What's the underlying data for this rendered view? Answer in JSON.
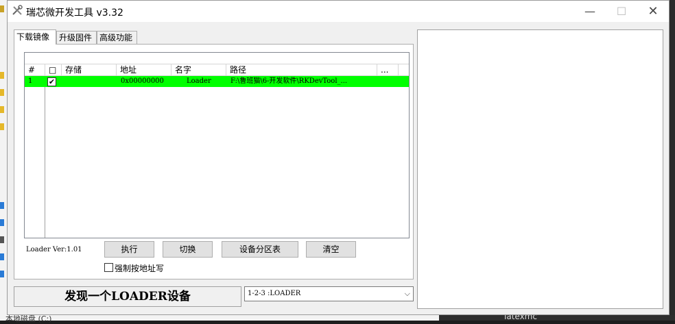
{
  "window": {
    "title": "瑞芯微开发工具 v3.32"
  },
  "tabs": [
    {
      "label": "下载镜像"
    },
    {
      "label": "升级固件"
    },
    {
      "label": "高级功能"
    }
  ],
  "list": {
    "headers": [
      "#",
      "□",
      "存储",
      "地址",
      "名字",
      "路径",
      "..."
    ],
    "rows": [
      {
        "index": "1",
        "checked": "✔",
        "storage": "",
        "address": "0x00000000",
        "name": "Loader",
        "path": "F:\\鲁班猫\\6-开发软件\\RKDevTool_..."
      }
    ]
  },
  "panel": {
    "loader_ver": "Loader Ver:1.01",
    "buttons": {
      "execute": "执行",
      "switch": "切换",
      "partition": "设备分区表",
      "clear": "清空"
    },
    "force_write": "强制按地址写"
  },
  "status": {
    "message": "发现一个LOADER设备",
    "device": "1-2-3 :LOADER"
  },
  "background": {
    "left_bottom_text": "本地磁盘 (C:)",
    "right_bottom_text": "latexmc"
  },
  "colors": {
    "selected_row": "#00ff00",
    "window_bg": "#f0f0f0"
  }
}
